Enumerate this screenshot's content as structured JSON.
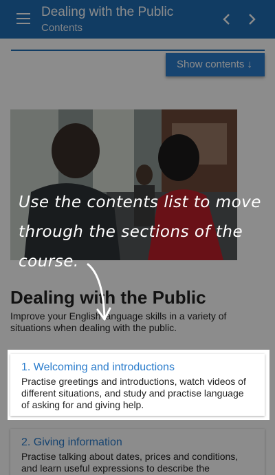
{
  "appbar": {
    "title": "Dealing with the Public",
    "subtitle": "Contents"
  },
  "toolbar": {
    "show_contents_label": "Show contents"
  },
  "photo": {
    "description_icon": "photo-image"
  },
  "main": {
    "title": "Dealing with the Public",
    "description": "Improve your English language skills in a variety of situations when dealing with the public."
  },
  "sections": [
    {
      "title": "1. Welcoming and introductions",
      "text": "Practise greetings and introductions, watch videos of different situations, and study and practise language of asking for and giving help."
    },
    {
      "title": "2. Giving information",
      "text": "Practise talking about dates, prices and conditions, and learn useful expressions to describe the"
    }
  ],
  "tutorial": {
    "text": "Use the contents list to move through the sections of the course."
  },
  "colors": {
    "accent": "#1f6eb5",
    "link": "#2a7ccc"
  }
}
